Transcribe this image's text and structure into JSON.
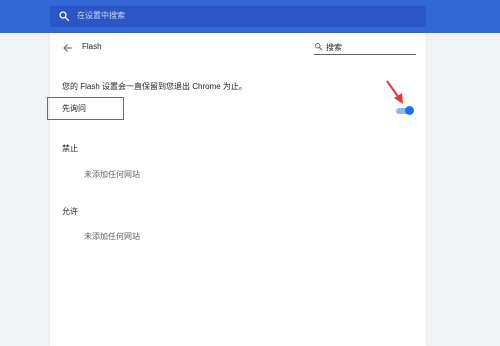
{
  "header": {
    "search_placeholder": "在设置中搜索"
  },
  "page": {
    "title": "Flash",
    "search_label": "搜索",
    "info_text": "您的 Flash 设置会一直保留到您退出 Chrome 为止。",
    "ask_first_label": "先询问",
    "ask_first_enabled": true,
    "block": {
      "label": "禁止",
      "empty_text": "未添加任何网站"
    },
    "allow": {
      "label": "允许",
      "empty_text": "未添加任何网站"
    }
  },
  "colors": {
    "header_bg": "#3367d6",
    "toggle_on": "#1a73e8",
    "annotation_red": "#e53935"
  }
}
